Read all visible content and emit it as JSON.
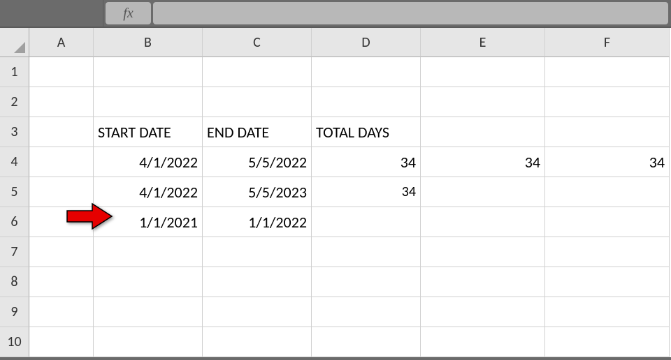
{
  "formula_bar": {
    "fx_label": "fx",
    "value": ""
  },
  "columns": [
    "A",
    "B",
    "C",
    "D",
    "E",
    "F"
  ],
  "rows": [
    "1",
    "2",
    "3",
    "4",
    "5",
    "6",
    "7",
    "8",
    "9",
    "10"
  ],
  "cells": {
    "B3": "START DATE",
    "C3": "END DATE",
    "D3": "TOTAL DAYS",
    "B4": "4/1/2022",
    "C4": "5/5/2022",
    "D4": "34",
    "E4": "34",
    "F4": "34",
    "B5": "4/1/2022",
    "C5": "5/5/2023",
    "D5": "34",
    "B6": "1/1/2021",
    "C6": "1/1/2022"
  },
  "annotation": {
    "arrow_points_to": "B6"
  }
}
